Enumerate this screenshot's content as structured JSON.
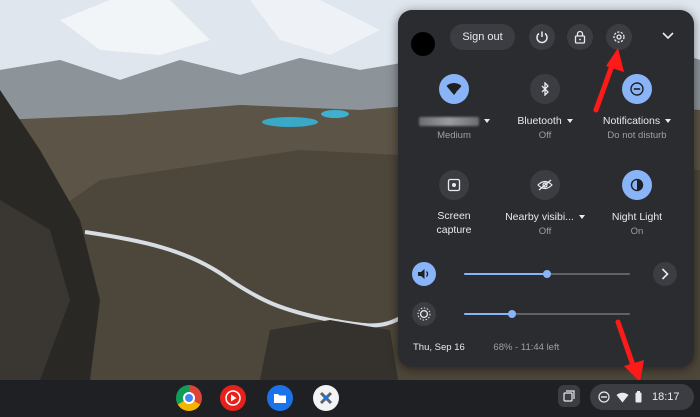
{
  "top_bar": {
    "sign_out_label": "Sign out",
    "power_icon": "power-icon",
    "lock_icon": "lock-icon",
    "settings_icon": "gear-icon",
    "collapse_icon": "chevron-down-icon"
  },
  "tiles": [
    {
      "id": "network",
      "label": "",
      "sublabel": "Medium",
      "icon": "wifi-icon",
      "active": true
    },
    {
      "id": "bluetooth",
      "label": "Bluetooth",
      "sublabel": "Off",
      "icon": "bluetooth-icon",
      "active": false
    },
    {
      "id": "notifications",
      "label": "Notifications",
      "sublabel": "Do not disturb",
      "icon": "do-not-disturb-icon",
      "active": true
    },
    {
      "id": "screen_capture",
      "label": "Screen capture",
      "icon": "screen-capture-icon",
      "active": false
    },
    {
      "id": "nearby",
      "label": "Nearby visibi...",
      "sublabel": "Off",
      "icon": "nearby-share-icon",
      "active": false
    },
    {
      "id": "night_light",
      "label": "Night Light",
      "sublabel": "On",
      "icon": "night-light-icon",
      "active": true
    }
  ],
  "volume": {
    "level": 0.5,
    "icon": "volume-icon"
  },
  "brightness": {
    "level": 0.29,
    "icon": "brightness-icon"
  },
  "footer": {
    "date": "Thu, Sep 16",
    "battery": "68% - 11:44 left"
  },
  "shelf": {
    "apps": [
      "chrome-icon",
      "youtube-music-icon",
      "files-icon",
      "app-icon"
    ],
    "time": "18:17"
  },
  "colors": {
    "panel_bg": "#2b2c30",
    "accent": "#8ab4f8",
    "annotation_arrow": "#ff1a1a"
  }
}
